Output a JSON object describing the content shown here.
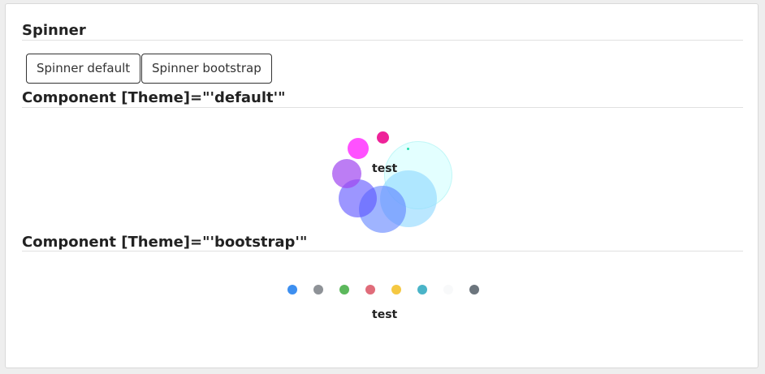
{
  "page": {
    "spinner_heading": "Spinner",
    "buttons": {
      "spinner_default_label": "Spinner default",
      "spinner_bootstrap_label": "Spinner bootstrap"
    },
    "default_section": {
      "heading": "Component [Theme]=\"'default'\"",
      "spinner_text": "test"
    },
    "bootstrap_section": {
      "heading": "Component [Theme]=\"'bootstrap'\"",
      "spinner_text": "test"
    }
  },
  "colors": {
    "default_bubbles": [
      "#ff33ff",
      "#ee2299",
      "#9966ee",
      "#5566ff",
      "#6688ff",
      "#99ddff",
      "#ccffff",
      "#22ddaa"
    ],
    "bootstrap_dots": [
      "#3d8ff0",
      "#8e9297",
      "#5cb85c",
      "#e06c7a",
      "#f5c842",
      "#4ab4c8",
      "#f8f9fa",
      "#6c757d"
    ]
  }
}
